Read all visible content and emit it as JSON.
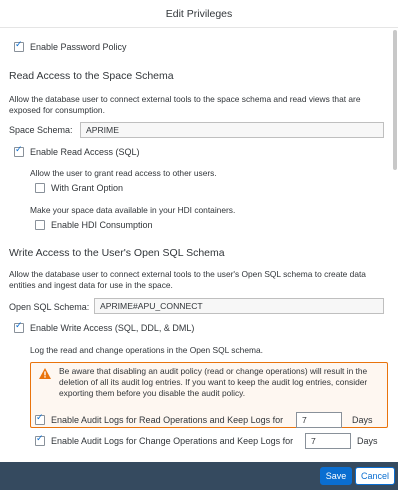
{
  "dialog": {
    "title": "Edit Privileges"
  },
  "password_policy": {
    "label": "Enable Password Policy",
    "checked": true
  },
  "read_access": {
    "title": "Read Access to the Space Schema",
    "description": "Allow the database user to connect external tools to the space schema and read views that are exposed for consumption.",
    "schema_label": "Space Schema:",
    "schema_value": "APRIME",
    "enable_read_label": "Enable Read Access (SQL)",
    "grant_description": "Allow the user to grant read access to other users.",
    "grant_option_label": "With Grant Option",
    "hdi_description": "Make your space data available in your HDI containers.",
    "hdi_label": "Enable HDI Consumption"
  },
  "write_access": {
    "title": "Write Access to the User's Open SQL Schema",
    "description": "Allow the database user to connect external tools to the user's Open SQL schema to create data entities and ingest data for use in the space.",
    "schema_label": "Open SQL Schema:",
    "schema_value": "APRIME#APU_CONNECT",
    "enable_write_label": "Enable Write Access (SQL, DDL, & DML)",
    "log_description": "Log the read and change operations in the Open SQL schema.",
    "warning_text": "Be aware that disabling an audit policy (read or change operations) will result in the deletion of all its audit log entries. If you want to keep the audit log entries, consider exporting them before you disable the audit policy.",
    "audit_read_label": "Enable Audit Logs for Read Operations and Keep Logs for",
    "audit_read_days": "7",
    "audit_change_label": "Enable Audit Logs for Change Operations and Keep Logs for",
    "audit_change_days": "7",
    "days_unit": "Days"
  },
  "footer": {
    "save_label": "Save",
    "cancel_label": "Cancel"
  },
  "colors": {
    "accent": "#0a6ed1",
    "footer_bg": "#354a5f",
    "warning_border": "#e9730c",
    "warning_bg": "#fef7f1"
  },
  "icons": {
    "warning": "warning-icon",
    "checkbox": "checkmark-icon"
  }
}
